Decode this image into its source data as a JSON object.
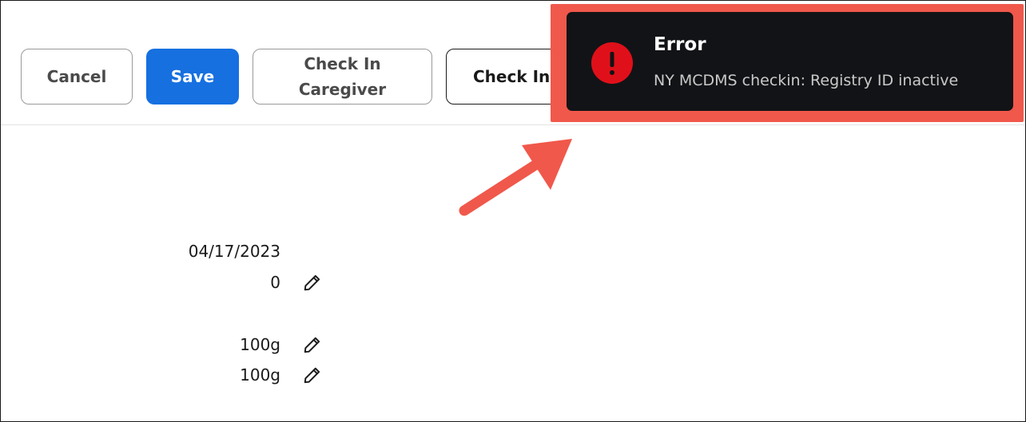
{
  "toolbar": {
    "cancel_label": "Cancel",
    "save_label": "Save",
    "checkin_caregiver_line1": "Check In",
    "checkin_caregiver_line2": "Caregiver",
    "checkin_label": "Check In"
  },
  "toast": {
    "title": "Error",
    "message": "NY MCDMS checkin: Registry ID inactive",
    "icon": "error-icon",
    "background_color": "#121316",
    "icon_color": "#e0101a",
    "highlight_color": "#f0584b"
  },
  "details": {
    "date": "04/17/2023",
    "count": "0",
    "weight_1": "100g",
    "weight_2": "100g"
  },
  "colors": {
    "primary": "#1670e0",
    "annotation": "#f0584b"
  }
}
